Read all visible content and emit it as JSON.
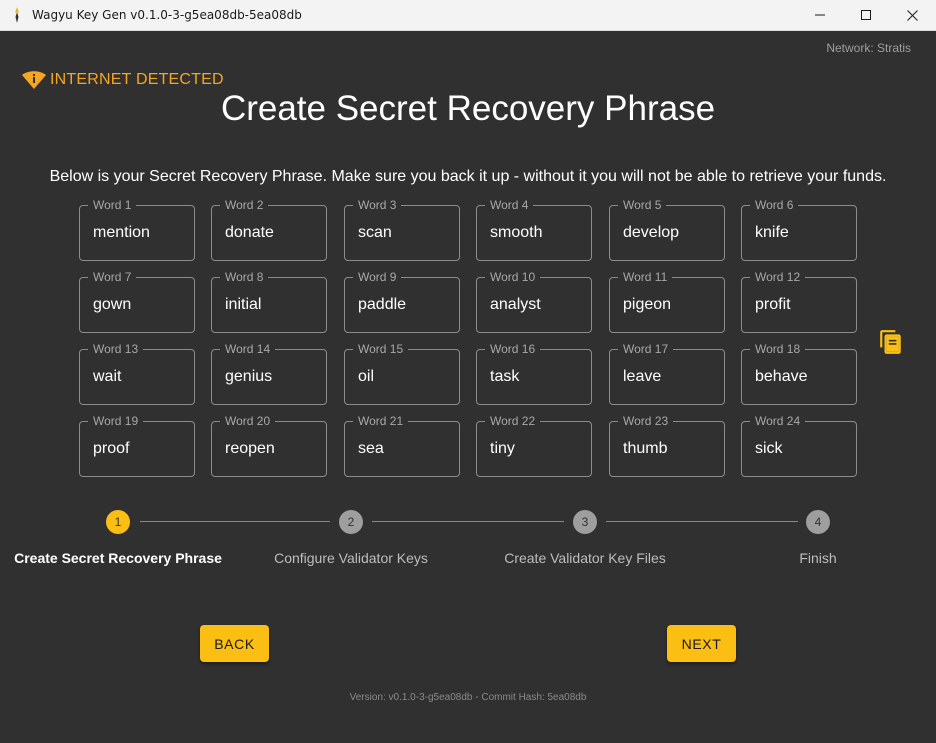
{
  "window": {
    "title": "Wagyu Key Gen v0.1.0-3-g5ea08db-5ea08db",
    "icon": "wagyu-logo-icon"
  },
  "header": {
    "network": "Network: Stratis",
    "warning": "INTERNET DETECTED",
    "warning_color": "#f5a623"
  },
  "main": {
    "title": "Create Secret Recovery Phrase",
    "instructions": "Below is your Secret Recovery Phrase. Make sure you back it up - without it you will not be able to retrieve your funds.",
    "words": [
      {
        "label": "Word 1",
        "value": "mention"
      },
      {
        "label": "Word 2",
        "value": "donate"
      },
      {
        "label": "Word 3",
        "value": "scan"
      },
      {
        "label": "Word 4",
        "value": "smooth"
      },
      {
        "label": "Word 5",
        "value": "develop"
      },
      {
        "label": "Word 6",
        "value": "knife"
      },
      {
        "label": "Word 7",
        "value": "gown"
      },
      {
        "label": "Word 8",
        "value": "initial"
      },
      {
        "label": "Word 9",
        "value": "paddle"
      },
      {
        "label": "Word 10",
        "value": "analyst"
      },
      {
        "label": "Word 11",
        "value": "pigeon"
      },
      {
        "label": "Word 12",
        "value": "profit"
      },
      {
        "label": "Word 13",
        "value": "wait"
      },
      {
        "label": "Word 14",
        "value": "genius"
      },
      {
        "label": "Word 15",
        "value": "oil"
      },
      {
        "label": "Word 16",
        "value": "task"
      },
      {
        "label": "Word 17",
        "value": "leave"
      },
      {
        "label": "Word 18",
        "value": "behave"
      },
      {
        "label": "Word 19",
        "value": "proof"
      },
      {
        "label": "Word 20",
        "value": "reopen"
      },
      {
        "label": "Word 21",
        "value": "sea"
      },
      {
        "label": "Word 22",
        "value": "tiny"
      },
      {
        "label": "Word 23",
        "value": "thumb"
      },
      {
        "label": "Word 24",
        "value": "sick"
      }
    ],
    "copy_icon": "copy-icon"
  },
  "stepper": {
    "steps": [
      {
        "number": "1",
        "label": "Create Secret Recovery Phrase",
        "active": true
      },
      {
        "number": "2",
        "label": "Configure Validator Keys",
        "active": false
      },
      {
        "number": "3",
        "label": "Create Validator Key Files",
        "active": false
      },
      {
        "number": "4",
        "label": "Finish",
        "active": false
      }
    ],
    "accent_color": "#fbbf14"
  },
  "navigation": {
    "back_label": "BACK",
    "next_label": "NEXT"
  },
  "footer": {
    "version": "Version: v0.1.0-3-g5ea08db - Commit Hash: 5ea08db"
  }
}
